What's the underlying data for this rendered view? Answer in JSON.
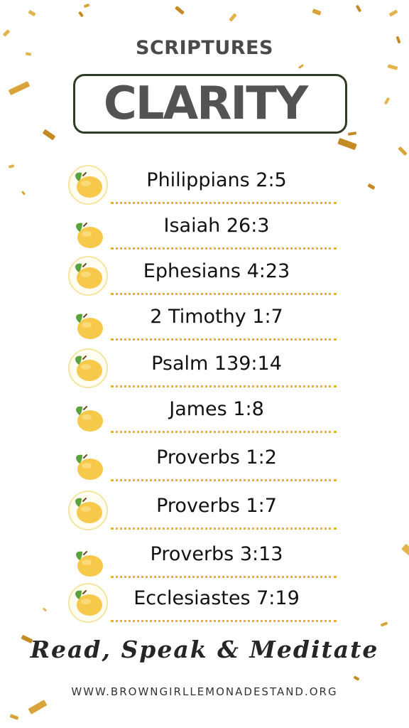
{
  "header": {
    "subtitle": "SCRIPTURES",
    "title": "CLARITY"
  },
  "scriptures": [
    {
      "ref": "Philippians 2:5",
      "icon": "lemon-badge-icon"
    },
    {
      "ref": "Isaiah 26:3",
      "icon": "lemon-icon"
    },
    {
      "ref": "Ephesians 4:23",
      "icon": "lemon-badge-icon"
    },
    {
      "ref": "2 Timothy 1:7",
      "icon": "lemon-icon"
    },
    {
      "ref": "Psalm 139:14",
      "icon": "lemon-badge-icon"
    },
    {
      "ref": "James 1:8",
      "icon": "lemon-icon"
    },
    {
      "ref": "Proverbs 1:2",
      "icon": "lemon-icon"
    },
    {
      "ref": "Proverbs 1:7",
      "icon": "lemon-badge-icon"
    },
    {
      "ref": "Proverbs 3:13",
      "icon": "lemon-icon"
    },
    {
      "ref": "Ecclesiastes 7:19",
      "icon": "lemon-badge-icon"
    }
  ],
  "footer": {
    "tagline": "Read, Speak & Meditate",
    "url": "WWW.BROWNGIRLLEMONADESTAND.ORG"
  },
  "colors": {
    "dots": "#e8b52a",
    "lemon": "#f7c94a",
    "leaf": "#5aa33c",
    "confetti": "#d9a43a",
    "title_border": "#2e3b26"
  }
}
